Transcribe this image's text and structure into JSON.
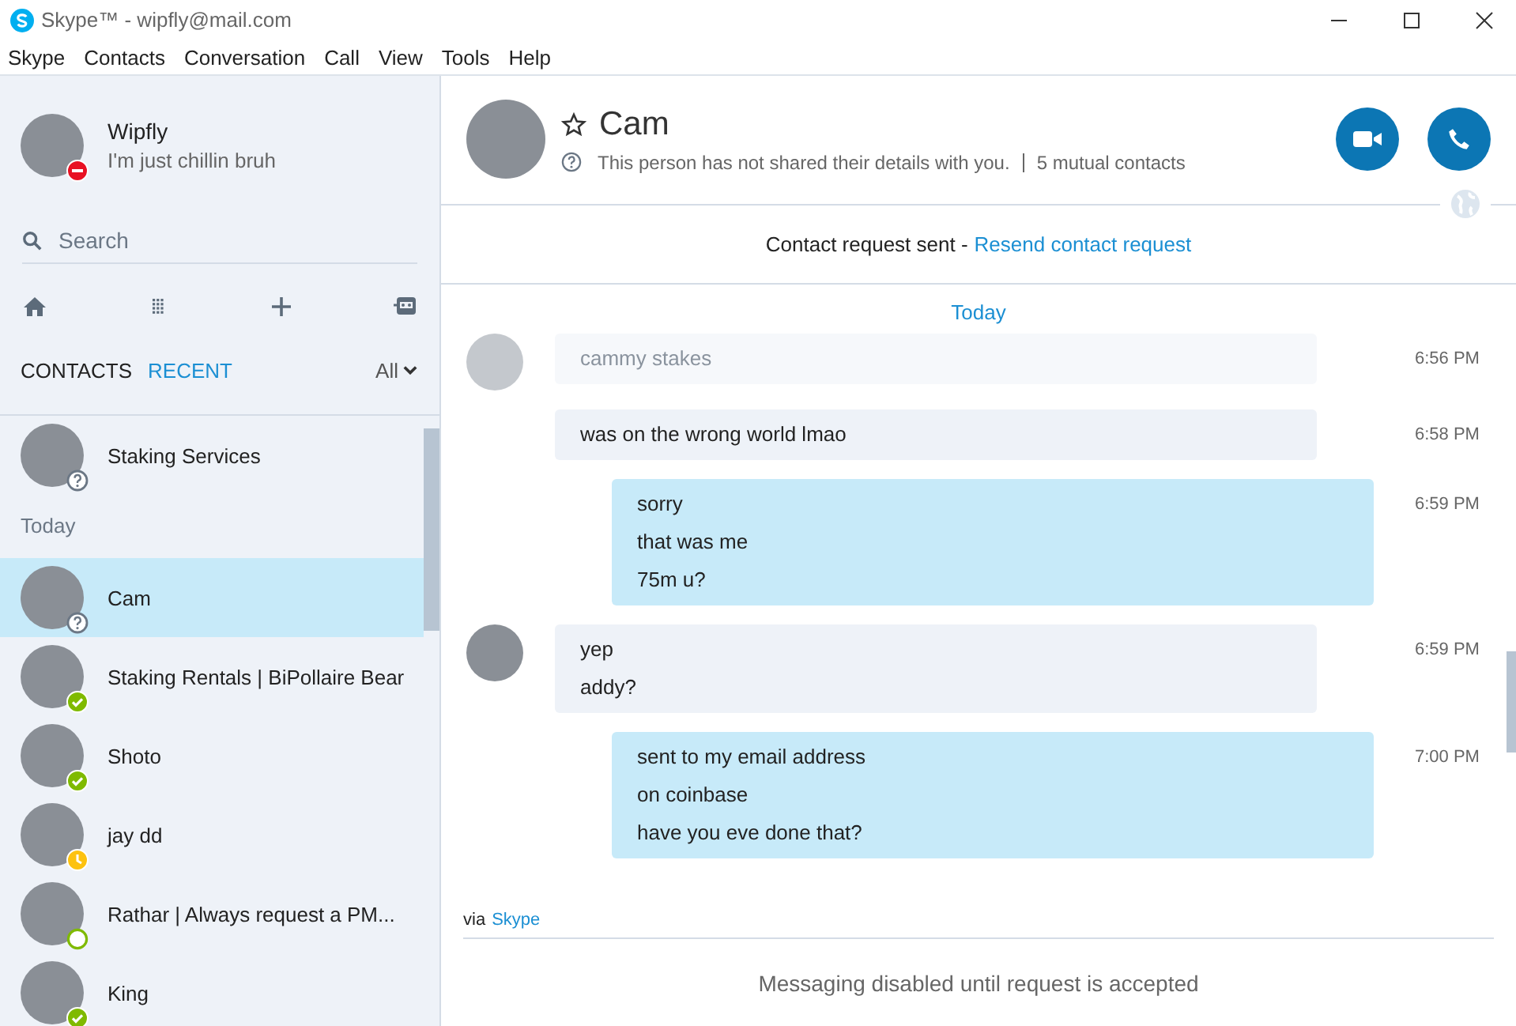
{
  "window": {
    "title": "Skype™ - wipfly@mail.com"
  },
  "menu": [
    "Skype",
    "Contacts",
    "Conversation",
    "Call",
    "View",
    "Tools",
    "Help"
  ],
  "profile": {
    "name": "Wipfly",
    "mood": "I'm just chillin bruh",
    "badge": {
      "kind": "busy"
    }
  },
  "search": {
    "placeholder": "Search"
  },
  "tabs": [
    {
      "label": "CONTACTS",
      "selected": false
    },
    {
      "label": "RECENT",
      "selected": true
    }
  ],
  "filter": {
    "label": "All"
  },
  "recent": [
    {
      "kind": "contact",
      "name": "Staking Services",
      "badge": {
        "kind": "unknown"
      },
      "selected": false
    },
    {
      "kind": "header",
      "label": "Today"
    },
    {
      "kind": "contact",
      "name": "Cam",
      "badge": {
        "kind": "unknown"
      },
      "selected": true
    },
    {
      "kind": "contact",
      "name": "Staking Rentals | BiPollaire Bear",
      "badge": {
        "kind": "online"
      },
      "selected": false
    },
    {
      "kind": "contact",
      "name": "Shoto",
      "badge": {
        "kind": "online"
      },
      "selected": false
    },
    {
      "kind": "contact",
      "name": "jay dd",
      "badge": {
        "kind": "away"
      },
      "selected": false
    },
    {
      "kind": "contact",
      "name": "Rathar | Always request a PM...",
      "badge": {
        "kind": "ring"
      },
      "selected": false
    },
    {
      "kind": "contact",
      "name": "King",
      "badge": {
        "kind": "online"
      },
      "selected": false
    }
  ],
  "conversation": {
    "name": "Cam",
    "info": "This person has not shared their details with you.",
    "mutual": "5 mutual contacts",
    "request_text": "Contact request sent -",
    "request_link": "Resend contact request",
    "day": "Today",
    "messages": [
      {
        "kind": "incoming",
        "avatar": true,
        "faded": true,
        "lines": [
          "cammy stakes"
        ],
        "time": "6:56 PM"
      },
      {
        "kind": "incoming",
        "avatar": false,
        "faded": false,
        "lines": [
          "was on the wrong world lmao"
        ],
        "time": "6:58 PM"
      },
      {
        "kind": "outgoing",
        "avatar": false,
        "faded": false,
        "lines": [
          "sorry",
          "that was me",
          "75m u?"
        ],
        "time": "6:59 PM"
      },
      {
        "kind": "incoming",
        "avatar": true,
        "faded": false,
        "lines": [
          "yep",
          "addy?"
        ],
        "time": "6:59 PM"
      },
      {
        "kind": "outgoing",
        "avatar": false,
        "faded": false,
        "lines": [
          "sent to my email address",
          "on coinbase",
          "have you eve done that?"
        ],
        "time": "7:00 PM"
      }
    ],
    "via": "via",
    "via_link": "Skype",
    "footer": "Messaging disabled until request is accepted"
  }
}
